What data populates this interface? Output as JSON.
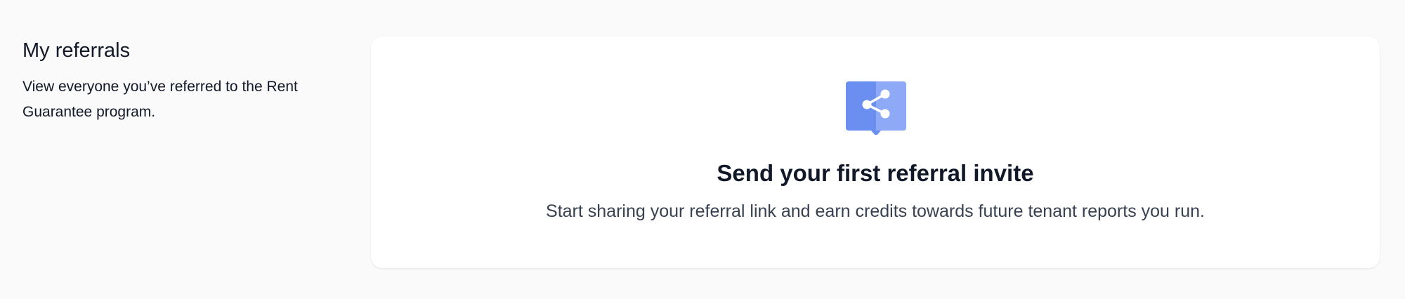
{
  "section": {
    "title": "My referrals",
    "description": "View everyone you’ve referred to the Rent Guarantee program."
  },
  "empty_state": {
    "icon": "share-icon",
    "title": "Send your first referral invite",
    "description": "Start sharing your referral link and earn credits towards future tenant reports you run."
  },
  "colors": {
    "page_background": "#fafafa",
    "card_background": "#ffffff",
    "icon_primary": "#6b8ff0",
    "icon_secondary": "#8ea9f5",
    "title_text": "#111827",
    "body_text": "#374151"
  }
}
